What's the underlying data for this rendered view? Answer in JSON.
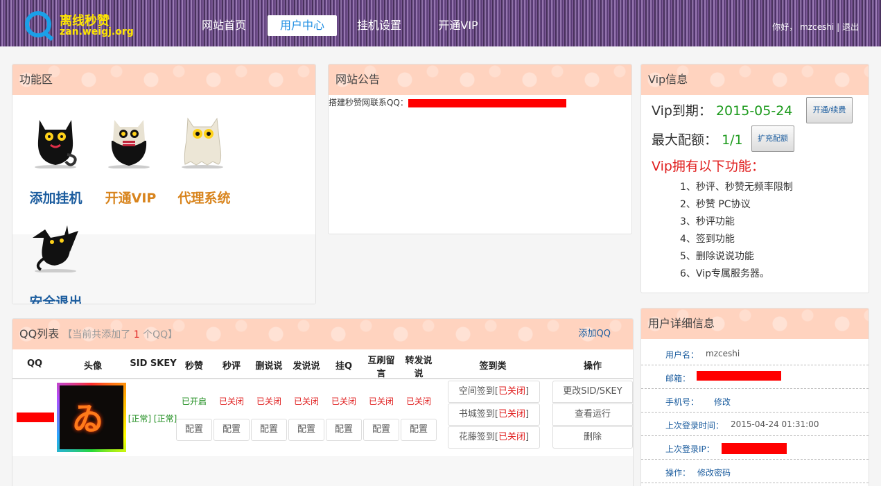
{
  "header": {
    "logo_title": "离线秒赞",
    "logo_url": "zan.weigj.org",
    "nav": [
      "网站首页",
      "用户中心",
      "挂机设置",
      "开通VIP"
    ],
    "greeting": "你好，",
    "username": "mzceshi",
    "separator": "|",
    "logout": "退出"
  },
  "func_panel": {
    "title": "功能区",
    "items": [
      {
        "label": "添加挂机",
        "icon": "black-cat-icon"
      },
      {
        "label": "开通VIP",
        "icon": "skull-cat-icon"
      },
      {
        "label": "代理系统",
        "icon": "ghost-cat-icon"
      },
      {
        "label": "安全退出",
        "icon": "bat-cat-icon"
      }
    ]
  },
  "notice_panel": {
    "title": "网站公告",
    "text": "搭建秒赞网联系QQ："
  },
  "vip_panel": {
    "title": "Vip信息",
    "expire_label": "Vip到期：",
    "expire_value": "2015-05-24",
    "renew_button": "开通/续费",
    "quota_label": "最大配额：",
    "quota_value": "1/1",
    "expand_button": "扩充配额",
    "features_title": "Vip拥有以下功能：",
    "features": [
      "1、秒评、秒赞无频率限制",
      "2、秒赞 PC协议",
      "3、秒评功能",
      "4、签到功能",
      "5、删除说说功能",
      "6、Vip专属服务器。"
    ]
  },
  "qq_panel": {
    "title": "QQ列表",
    "note_prefix": "【当前共添加了",
    "note_count": "1",
    "note_suffix": "个QQ】",
    "add_link": "添加QQ",
    "columns": [
      "QQ",
      "头像",
      "SID SKEY",
      "秒赞",
      "秒评",
      "删说说",
      "发说说",
      "挂Q",
      "互刷留言",
      "转发说说",
      "签到类",
      "操作"
    ],
    "row": {
      "sid_status": "[正常]",
      "skey_status": "[正常]",
      "statuses": [
        "已开启",
        "已关闭",
        "已关闭",
        "已关闭",
        "已关闭",
        "已关闭",
        "已关闭"
      ],
      "config_label": "配置",
      "sign_items": [
        {
          "name": "空间签到",
          "status": "已关闭"
        },
        {
          "name": "书城签到",
          "status": "已关闭"
        },
        {
          "name": "花藤签到",
          "status": "已关闭"
        }
      ],
      "actions": [
        "更改SID/SKEY",
        "查看运行",
        "删除"
      ]
    }
  },
  "user_panel": {
    "title": "用户详细信息",
    "rows": [
      {
        "label": "用户名：",
        "value": "mzceshi"
      },
      {
        "label": "邮箱：",
        "value": ""
      },
      {
        "label": "手机号：",
        "value": "修改"
      },
      {
        "label": "上次登录时间：",
        "value": "2015-04-24 01:31:00"
      },
      {
        "label": "上次登录IP：",
        "value": ""
      },
      {
        "label": "操作：",
        "value": "修改密码"
      }
    ]
  },
  "colors": {
    "accent_blue": "#1b5c9e",
    "vip_green": "#1c9a1c",
    "alert_red": "#e01e1e",
    "panel_head": "#ffd3bf"
  }
}
